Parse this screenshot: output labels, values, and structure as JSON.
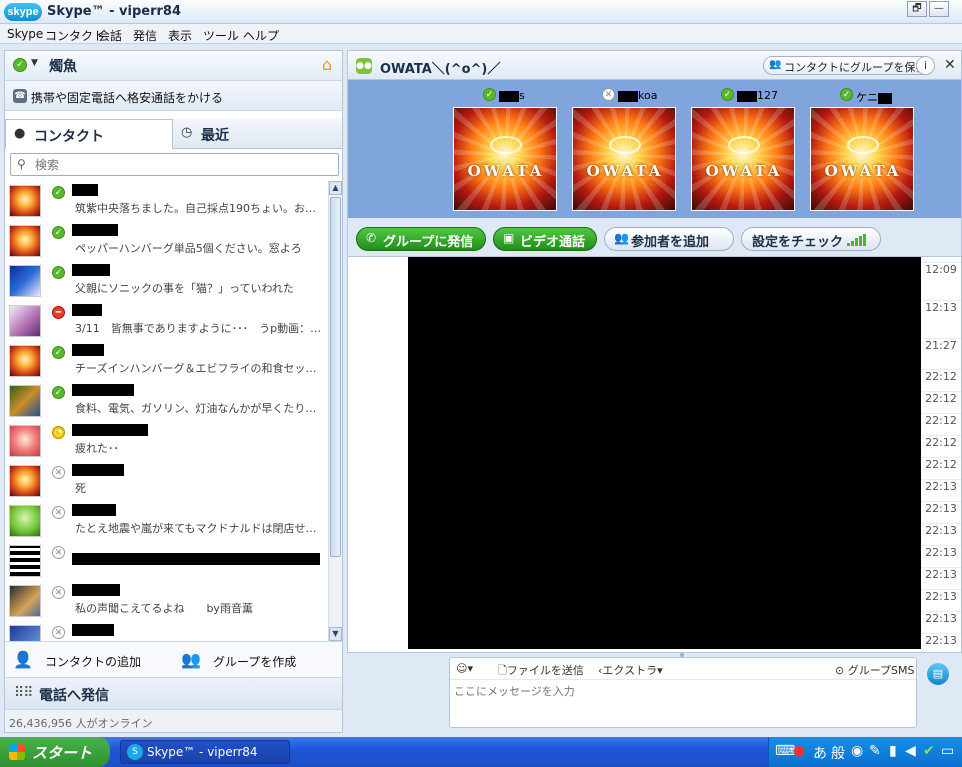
{
  "window": {
    "logo_text": "skype",
    "title": "Skype™ - viperr84",
    "controls": {
      "restore": "🗗",
      "minimize": "—",
      "close": "✕"
    }
  },
  "menu": [
    "Skype",
    "コンタクト",
    "会話",
    "発信",
    "表示",
    "ツール",
    "ヘルプ"
  ],
  "profile": {
    "name": "燭魚",
    "status": "online"
  },
  "call_promo": "携帯や固定電話へ格安通話をかける",
  "tabs": {
    "contacts": "コンタクト",
    "recent": "最近"
  },
  "search": {
    "placeholder": "検索"
  },
  "contacts": [
    {
      "status": "online",
      "mood": "筑紫中央落ちました。自己採点190ちょい。おちま…",
      "avatar": "owata"
    },
    {
      "status": "online",
      "mood": "ペッパーハンバーグ単品5個ください。窓よろ",
      "avatar": "owata"
    },
    {
      "status": "online",
      "mood": "父親にソニックの事を「猫？」っていわれた",
      "avatar": "sonic"
    },
    {
      "status": "busy",
      "mood": "3/11　皆無事でありますように･･･　うp動画：sm13…",
      "avatar": "anime"
    },
    {
      "status": "online",
      "mood": "チーズインハンバーグ＆エビフライの和食セット大盛…",
      "avatar": "owata"
    },
    {
      "status": "online",
      "mood": "食料、電気、ガソリン、灯油なんかが早くたりるよう…",
      "avatar": "game"
    },
    {
      "status": "away",
      "mood": "疲れた･･",
      "avatar": "owata2"
    },
    {
      "status": "offline",
      "mood": "死",
      "avatar": "owata"
    },
    {
      "status": "offline",
      "mood": "たとえ地震や嵐が来てもマクドナルドは閉店せず・・・",
      "avatar": "green"
    },
    {
      "status": "offline",
      "mood": "",
      "avatar": "qr"
    },
    {
      "status": "offline",
      "mood": "私の声聞こえてるよね　　by雨音薫",
      "avatar": "people"
    },
    {
      "status": "offline",
      "mood": "",
      "avatar": "blue"
    }
  ],
  "left_bottom": {
    "add_contact": "コンタクトの追加",
    "create_group": "グループを作成",
    "dial": "電話へ発信",
    "online_count": "26,436,956 人がオンライン"
  },
  "conversation": {
    "title": "OWATA＼(^o^)／",
    "save_group": "コンタクトにグループを保存",
    "info": "i",
    "close": "✕",
    "participants": [
      {
        "prefix": "",
        "suffix": "s",
        "status": "online"
      },
      {
        "prefix": "",
        "suffix": "koa",
        "status": "offline"
      },
      {
        "prefix": "",
        "suffix": "127",
        "status": "online"
      },
      {
        "prefix": "ケニ",
        "suffix": "",
        "status": "online"
      }
    ],
    "participant_image_text": "OWATA",
    "actions": {
      "group_call": "グループに発信",
      "video_call": "ビデオ通話",
      "add_participant": "参加者を追加",
      "check_settings": "設定をチェック"
    },
    "timestamps": [
      "12:09",
      "12:13",
      "21:27",
      "22:12",
      "22:12",
      "22:12",
      "22:12",
      "22:12",
      "22:13",
      "22:13",
      "22:13",
      "22:13",
      "22:13",
      "22:13",
      "22:13",
      "22:13"
    ],
    "input": {
      "emoticon": "☺▾",
      "send_file": "ファイルを送信",
      "extras": "エクストラ▾",
      "group_sms": "グループSMS",
      "placeholder": "ここにメッセージを入力"
    }
  },
  "taskbar": {
    "start": "スタート",
    "task": "Skype™ - viperr84",
    "tray": [
      "⌨",
      "あ",
      "般"
    ]
  }
}
